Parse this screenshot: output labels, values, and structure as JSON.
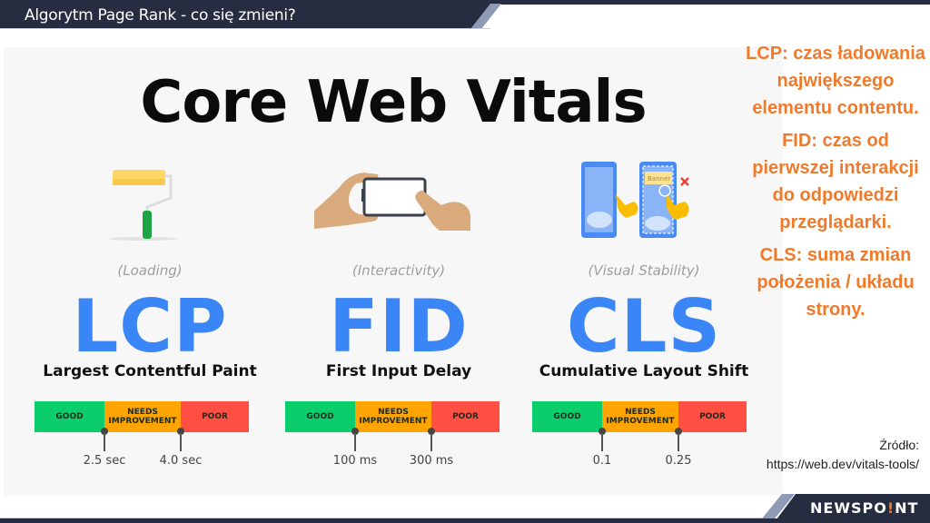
{
  "header": {
    "title": "Algorytm Page Rank - co się zmieni?"
  },
  "panel": {
    "title": "Core Web Vitals",
    "metrics": [
      {
        "illustration": "paint-roller-icon",
        "category": "(Loading)",
        "abbr": "LCP",
        "name": "Largest Contentful Paint",
        "segments": {
          "good": "GOOD",
          "needs_improvement": "NEEDS IMPROVEMENT",
          "poor": "POOR"
        },
        "thresholds": [
          "2.5 sec",
          "4.0 sec"
        ]
      },
      {
        "illustration": "hands-holding-phone-icon",
        "category": "(Interactivity)",
        "abbr": "FID",
        "name": "First Input Delay",
        "segments": {
          "good": "GOOD",
          "needs_improvement": "NEEDS IMPROVEMENT",
          "poor": "POOR"
        },
        "thresholds": [
          "100 ms",
          "300 ms"
        ]
      },
      {
        "illustration": "phones-layout-shift-icon",
        "category": "(Visual Stability)",
        "abbr": "CLS",
        "name": "Cumulative Layout Shift",
        "segments": {
          "good": "GOOD",
          "needs_improvement": "NEEDS IMPROVEMENT",
          "poor": "POOR"
        },
        "thresholds": [
          "0.1",
          "0.25"
        ],
        "banner_label": "Banner"
      }
    ],
    "colors": {
      "good": "#0ccd6b",
      "needs_improvement": "#ffa400",
      "poor": "#ff4e42",
      "metric_accent": "#3b86f7"
    }
  },
  "side": {
    "lcp": "LCP: czas ładowania największego elementu contentu.",
    "fid": "FID: czas od pierwszej interakcji do odpowiedzi przeglądarki.",
    "cls": "CLS: suma zmian położenia / układu strony.",
    "accent": "#f07a2a"
  },
  "source": {
    "label": "Źródło:",
    "url": "https://web.dev/vitals-tools/"
  },
  "footer": {
    "brand_part1": "NEWSPO",
    "brand_bang": "!",
    "brand_part2": "NT"
  }
}
